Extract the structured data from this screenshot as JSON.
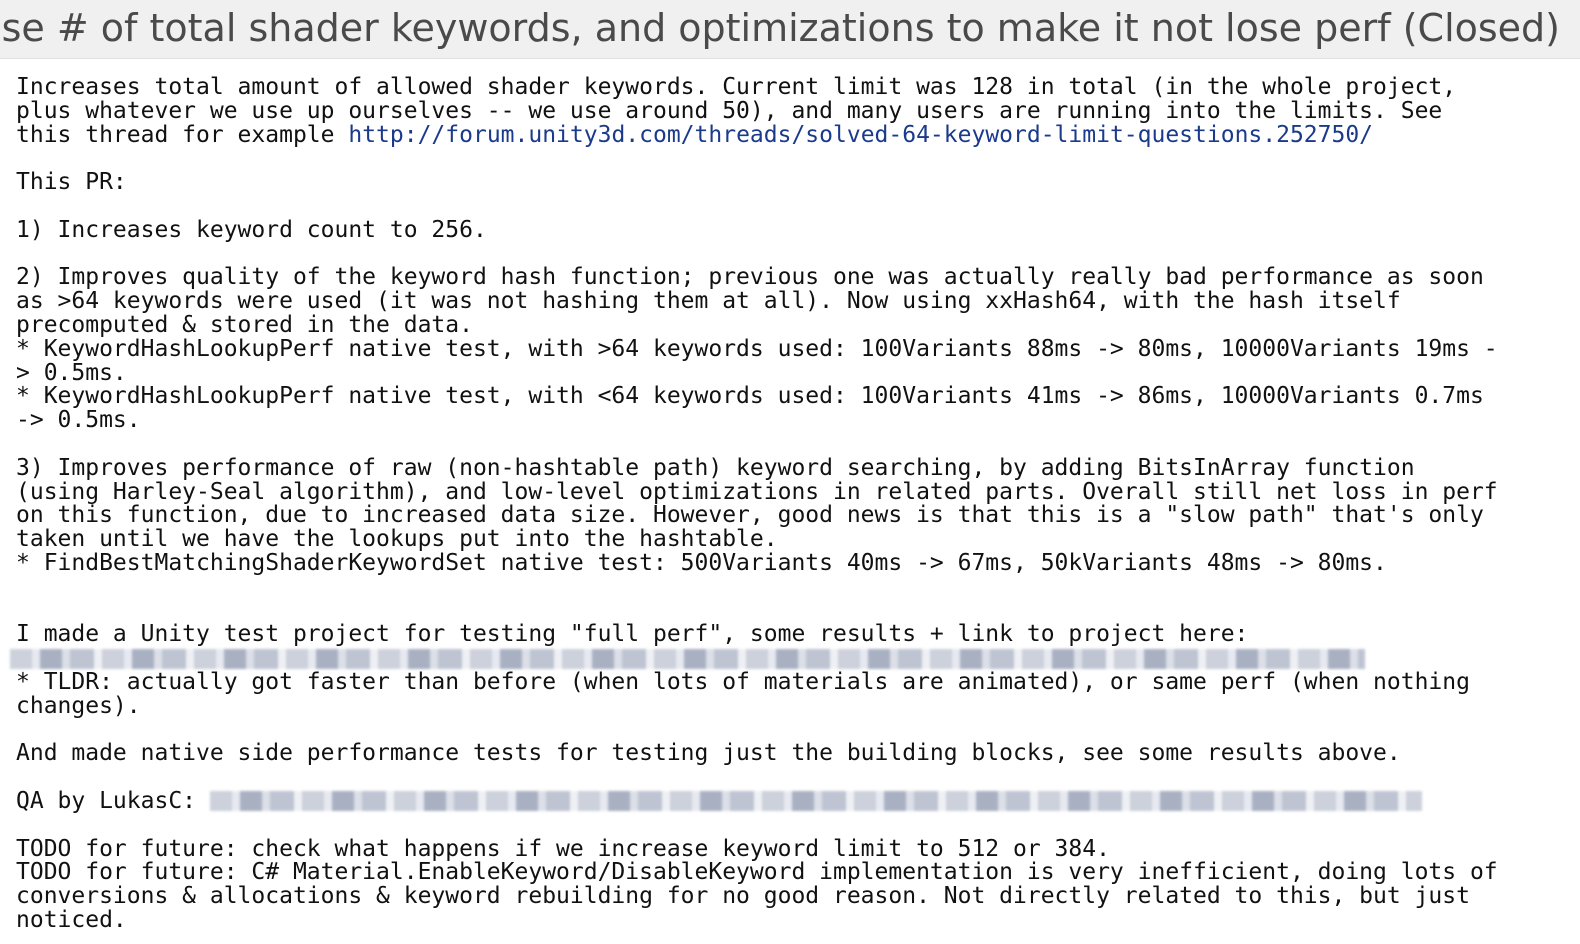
{
  "title": "ease # of total shader keywords, and optimizations to make it not lose perf (Closed)",
  "body": {
    "intro_line1": "Increases total amount of allowed shader keywords. Current limit was 128 in total (in the whole project,",
    "intro_line2": "plus whatever we use up ourselves -- we use around 50), and many users are running into the limits. See",
    "intro_line3_prefix": "this thread for example ",
    "intro_link": "http://forum.unity3d.com/threads/solved-64-keyword-limit-questions.252750/",
    "pr_header": "This PR:",
    "item1": "1) Increases keyword count to 256.",
    "item2_line1": "2) Improves quality of the keyword hash function; previous one was actually really bad performance as soon",
    "item2_line2": "as >64 keywords were used (it was not hashing them at all). Now using xxHash64, with the hash itself",
    "item2_line3": "precomputed & stored in the data.",
    "item2_line4": "* KeywordHashLookupPerf native test, with >64 keywords used: 100Variants 88ms -> 80ms, 10000Variants 19ms -",
    "item2_line5": "> 0.5ms.",
    "item2_line6": "* KeywordHashLookupPerf native test, with <64 keywords used: 100Variants 41ms -> 86ms, 10000Variants 0.7ms",
    "item2_line7": "-> 0.5ms.",
    "item3_line1": "3) Improves performance of raw (non-hashtable path) keyword searching, by adding BitsInArray function",
    "item3_line2": "(using Harley-Seal algorithm), and low-level optimizations in related parts. Overall still net loss in perf",
    "item3_line3": "on this function, due to increased data size. However, good news is that this is a \"slow path\" that's only",
    "item3_line4": "taken until we have the lookups put into the hashtable.",
    "item3_line5": "* FindBestMatchingShaderKeywordSet native test: 500Variants 40ms -> 67ms, 50kVariants 48ms -> 80ms.",
    "unity_line": "I made a Unity test project for testing \"full perf\", some results + link to project here:",
    "tldr_line1": "* TLDR: actually got faster than before (when lots of materials are animated), or same perf (when nothing",
    "tldr_line2": "changes).",
    "native_line": "And made native side performance tests for testing just the building blocks, see some results above.",
    "qa_label": "QA by LukasC:",
    "todo1": "TODO for future: check what happens if we increase keyword limit to 512 or 384.",
    "todo2_line1": "TODO for future: C# Material.EnableKeyword/DisableKeyword implementation is very inefficient, doing lots of",
    "todo2_line2": "conversions & allocations & keyword rebuilding for no good reason. Not directly related to this, but just",
    "todo2_line3": "noticed."
  }
}
